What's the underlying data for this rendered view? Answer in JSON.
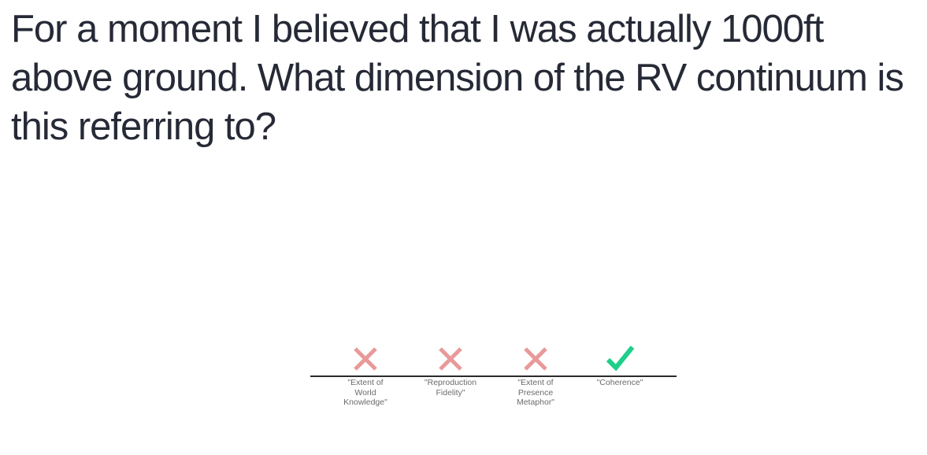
{
  "question": {
    "text": "For a moment I believed that I was actually 1000ft above ground. What dimension of the RV continuum is this referring to?"
  },
  "options": [
    {
      "label": "\"Extent of\nWorld\nKnowledge\"",
      "status": "incorrect",
      "icon": "cross-icon"
    },
    {
      "label": "\"Reproduction\nFidelity\"",
      "status": "incorrect",
      "icon": "cross-icon"
    },
    {
      "label": "\"Extent of\nPresence\nMetaphor\"",
      "status": "incorrect",
      "icon": "cross-icon"
    },
    {
      "label": "\"Coherence\"",
      "status": "correct",
      "icon": "check-icon"
    }
  ],
  "colors": {
    "text": "#262a36",
    "incorrect": "#e89a9a",
    "correct": "#1ecf8a",
    "baseline": "#2b2b2b",
    "label": "#6b6b6b"
  }
}
